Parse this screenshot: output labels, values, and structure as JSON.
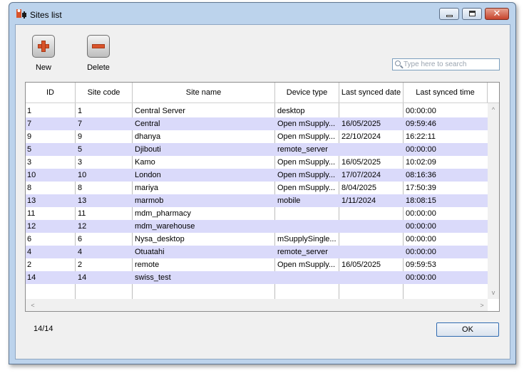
{
  "window": {
    "title": "Sites list",
    "close_glyph": "✕",
    "colors": {
      "frame": "#bcd3ec",
      "row_alt": "#dadafa",
      "accent_button": "#d9532a"
    }
  },
  "toolbar": {
    "new_label": "New",
    "delete_label": "Delete",
    "new_icon": "plus-icon",
    "delete_icon": "minus-icon"
  },
  "search": {
    "placeholder": "Type here to search",
    "value": ""
  },
  "table": {
    "columns": [
      "ID",
      "Site code",
      "Site name",
      "Device type",
      "Last synced date",
      "Last synced time"
    ],
    "rows": [
      [
        "1",
        "1",
        "Central Server",
        "desktop",
        "",
        "00:00:00"
      ],
      [
        "7",
        "7",
        "Central",
        "Open mSupply...",
        "16/05/2025",
        "09:59:46"
      ],
      [
        "9",
        "9",
        "dhanya",
        "Open mSupply...",
        "22/10/2024",
        "16:22:11"
      ],
      [
        "5",
        "5",
        "Djibouti",
        "remote_server",
        "",
        "00:00:00"
      ],
      [
        "3",
        "3",
        "Kamo",
        "Open mSupply...",
        "16/05/2025",
        "10:02:09"
      ],
      [
        "10",
        "10",
        "London",
        "Open mSupply...",
        "17/07/2024",
        "08:16:36"
      ],
      [
        "8",
        "8",
        "mariya",
        "Open mSupply...",
        "8/04/2025",
        "17:50:39"
      ],
      [
        "13",
        "13",
        "marmob",
        "mobile",
        "1/11/2024",
        "18:08:15"
      ],
      [
        "11",
        "11",
        "mdm_pharmacy",
        "",
        "",
        "00:00:00"
      ],
      [
        "12",
        "12",
        "mdm_warehouse",
        "",
        "",
        "00:00:00"
      ],
      [
        "6",
        "6",
        "Nysa_desktop",
        "mSupplySingle...",
        "",
        "00:00:00"
      ],
      [
        "4",
        "4",
        "Otuatahi",
        "remote_server",
        "",
        "00:00:00"
      ],
      [
        "2",
        "2",
        "remote",
        "Open mSupply...",
        "16/05/2025",
        "09:59:53"
      ],
      [
        "14",
        "14",
        "swiss_test",
        "",
        "",
        "00:00:00"
      ]
    ]
  },
  "scroll": {
    "up": "^",
    "down": "v",
    "left": "<",
    "right": ">"
  },
  "footer": {
    "count": "14/14",
    "ok_label": "OK"
  }
}
